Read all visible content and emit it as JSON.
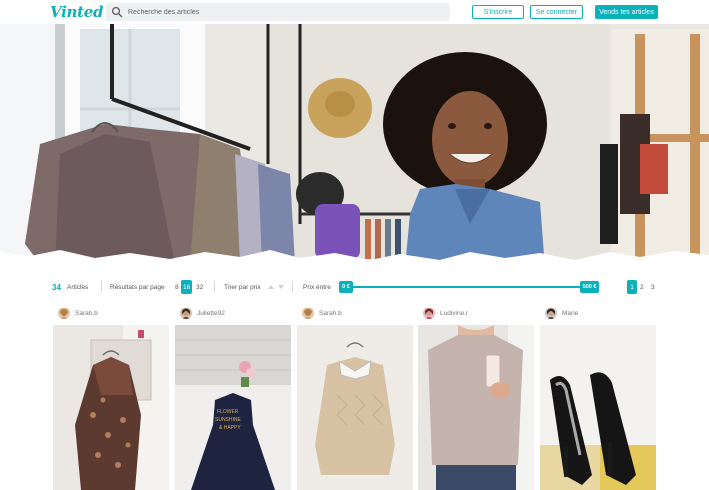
{
  "header": {
    "logo": "Vinted",
    "search_placeholder": "Recherche des articles",
    "register_label": "S'inscrire",
    "login_label": "Se connecter",
    "sell_label": "Vends tes articles"
  },
  "filters": {
    "article_count": "34",
    "articles_label": "Articles",
    "per_page_label": "Résultats par page",
    "per_page_options": [
      "8",
      "16",
      "32"
    ],
    "per_page_selected": "16",
    "sort_label": "Trier par prix",
    "price_label": "Prix entre",
    "price_min": "0 €",
    "price_max": "500 €",
    "pages": [
      "1",
      "2",
      "3"
    ],
    "current_page": "1"
  },
  "products": [
    {
      "user": "Sarah.b"
    },
    {
      "user": "Juliette92"
    },
    {
      "user": "Sarah.b"
    },
    {
      "user": "Ludivine.r"
    },
    {
      "user": "Marie"
    }
  ],
  "colors": {
    "brand": "#09b1ba",
    "search_bg": "#eef0f2"
  }
}
